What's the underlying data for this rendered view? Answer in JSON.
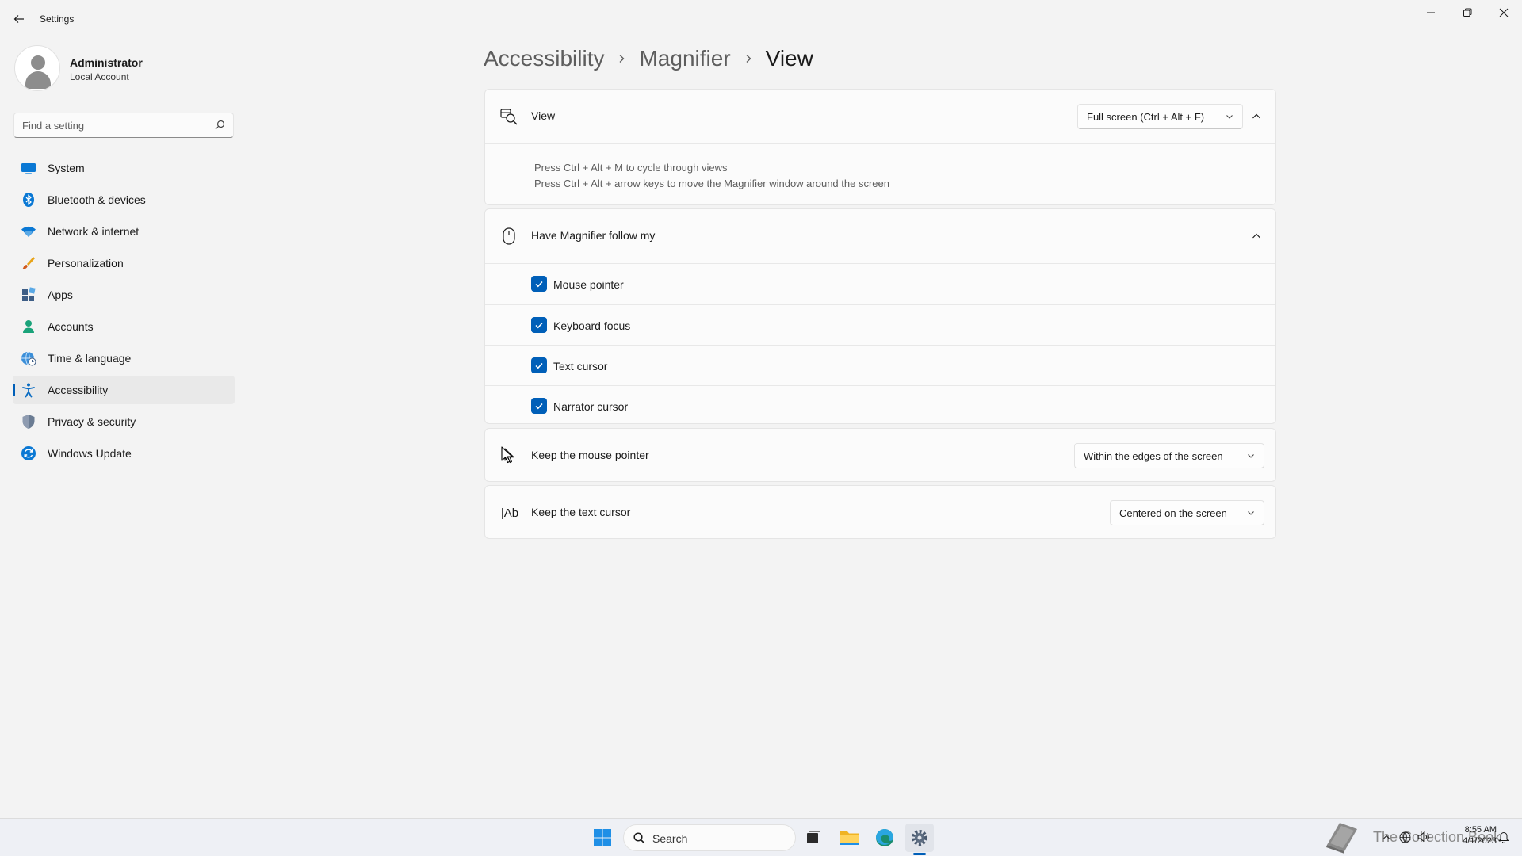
{
  "window": {
    "title": "Settings"
  },
  "profile": {
    "name": "Administrator",
    "account_type": "Local Account"
  },
  "search": {
    "placeholder": "Find a setting"
  },
  "sidebar": {
    "items": [
      {
        "label": "System",
        "icon": "monitor-icon"
      },
      {
        "label": "Bluetooth & devices",
        "icon": "bluetooth-icon"
      },
      {
        "label": "Network & internet",
        "icon": "wifi-icon"
      },
      {
        "label": "Personalization",
        "icon": "brush-icon"
      },
      {
        "label": "Apps",
        "icon": "apps-icon"
      },
      {
        "label": "Accounts",
        "icon": "person-icon"
      },
      {
        "label": "Time & language",
        "icon": "globe-clock-icon"
      },
      {
        "label": "Accessibility",
        "icon": "accessibility-icon",
        "active": true
      },
      {
        "label": "Privacy & security",
        "icon": "shield-icon"
      },
      {
        "label": "Windows Update",
        "icon": "update-icon"
      }
    ]
  },
  "breadcrumb": {
    "items": [
      "Accessibility",
      "Magnifier",
      "View"
    ]
  },
  "view_card": {
    "title": "View",
    "dropdown_value": "Full screen (Ctrl + Alt + F)",
    "hint_line1": "Press Ctrl + Alt + M to cycle through views",
    "hint_line2": "Press Ctrl + Alt + arrow keys to move the Magnifier window around the screen"
  },
  "follow_card": {
    "title": "Have Magnifier follow my",
    "options": [
      {
        "label": "Mouse pointer",
        "checked": true
      },
      {
        "label": "Keyboard focus",
        "checked": true
      },
      {
        "label": "Text cursor",
        "checked": true
      },
      {
        "label": "Narrator cursor",
        "checked": true
      }
    ]
  },
  "mouse_pointer_card": {
    "title": "Keep the mouse pointer",
    "dropdown_value": "Within the edges of the screen"
  },
  "text_cursor_card": {
    "title": "Keep the text cursor",
    "icon_text": "|Ab",
    "dropdown_value": "Centered on the screen"
  },
  "taskbar": {
    "search_label": "Search",
    "time": "8:55 AM",
    "date": "4/1/2023"
  },
  "watermark": {
    "text": "The Collection Book"
  },
  "colors": {
    "accent": "#005fb8",
    "background": "#f3f3f3",
    "card": "#fbfbfb"
  }
}
